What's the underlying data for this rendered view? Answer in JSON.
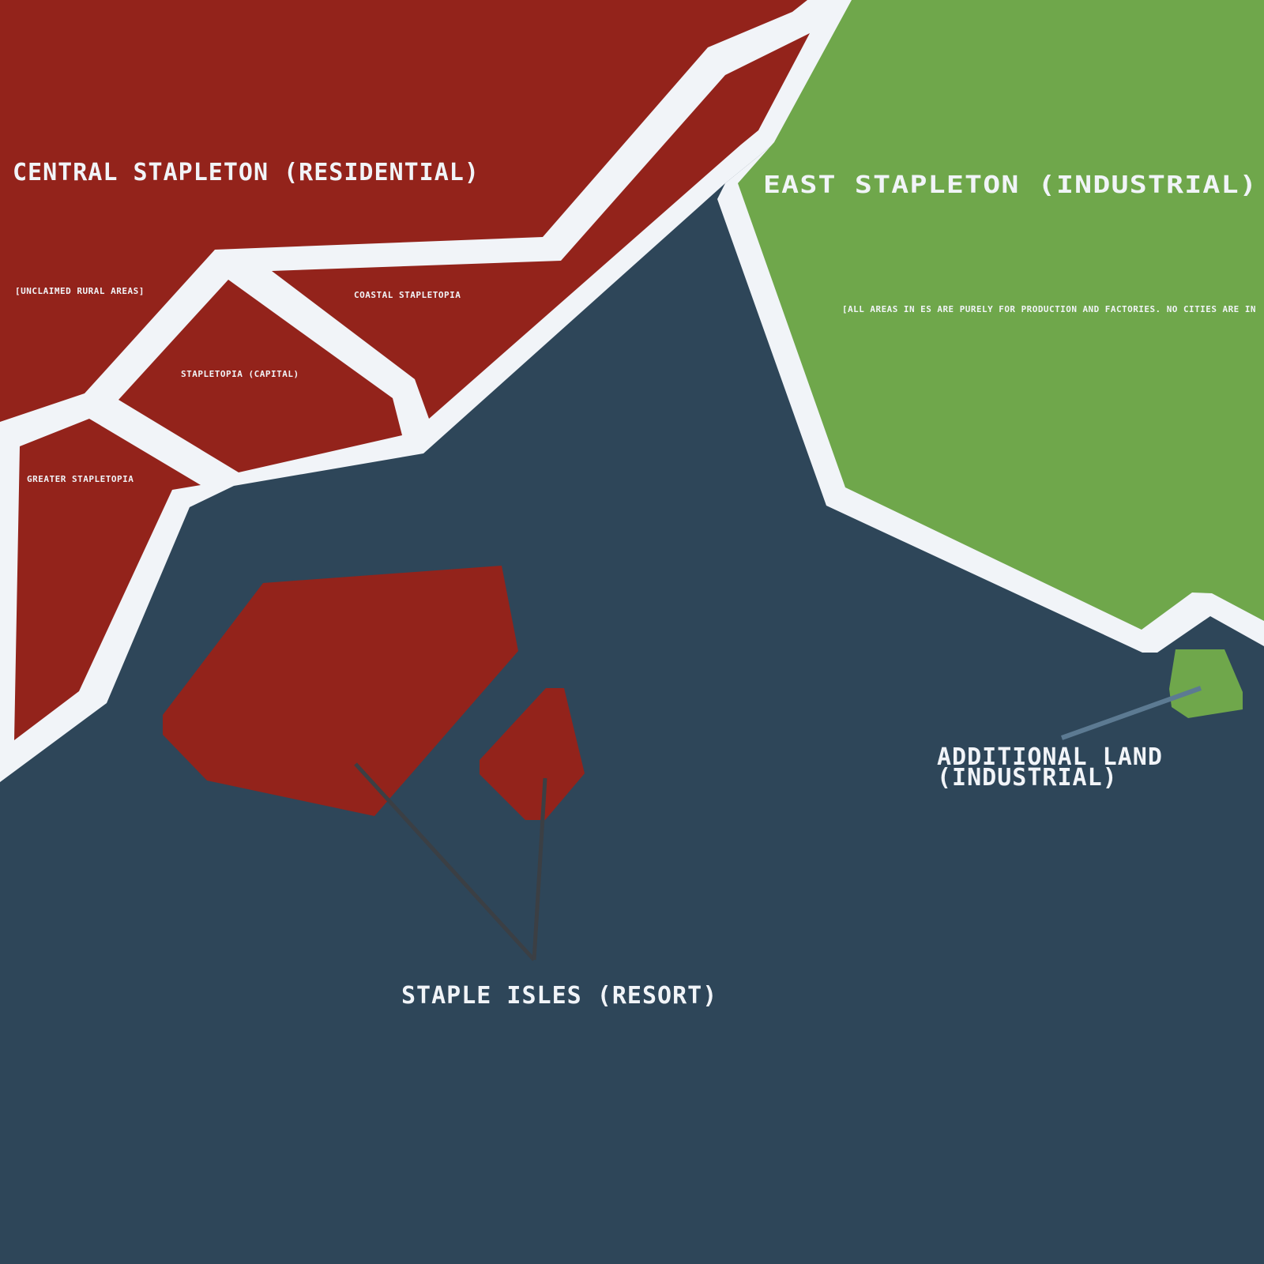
{
  "colors": {
    "sea": "#2e4659",
    "residential": "#93231b",
    "industrial": "#6fa74b",
    "border": "#f1f4f8",
    "label": "#f1f4f8",
    "pointer_islands": "#3b3f44",
    "pointer_additional": "#5c7a92"
  },
  "regions": {
    "central": {
      "label": "CENTRAL STAPLETON (RESIDENTIAL)",
      "subregions": {
        "unclaimed": "[UNCLAIMED RURAL AREAS]",
        "coastal": "COASTAL STAPLETOPIA",
        "capital": "STAPLETOPIA (CAPITAL)",
        "greater": "GREATER STAPLETOPIA"
      }
    },
    "east": {
      "label": "EAST STAPLETON (INDUSTRIAL)",
      "note": "[ALL AREAS IN ES ARE PURELY FOR PRODUCTION AND FACTORIES. NO CITIES ARE IN"
    },
    "isles": {
      "label": "STAPLE ISLES (RESORT)"
    },
    "additional": {
      "label_line1": "ADDITIONAL LAND",
      "label_line2": "(INDUSTRIAL)"
    }
  }
}
